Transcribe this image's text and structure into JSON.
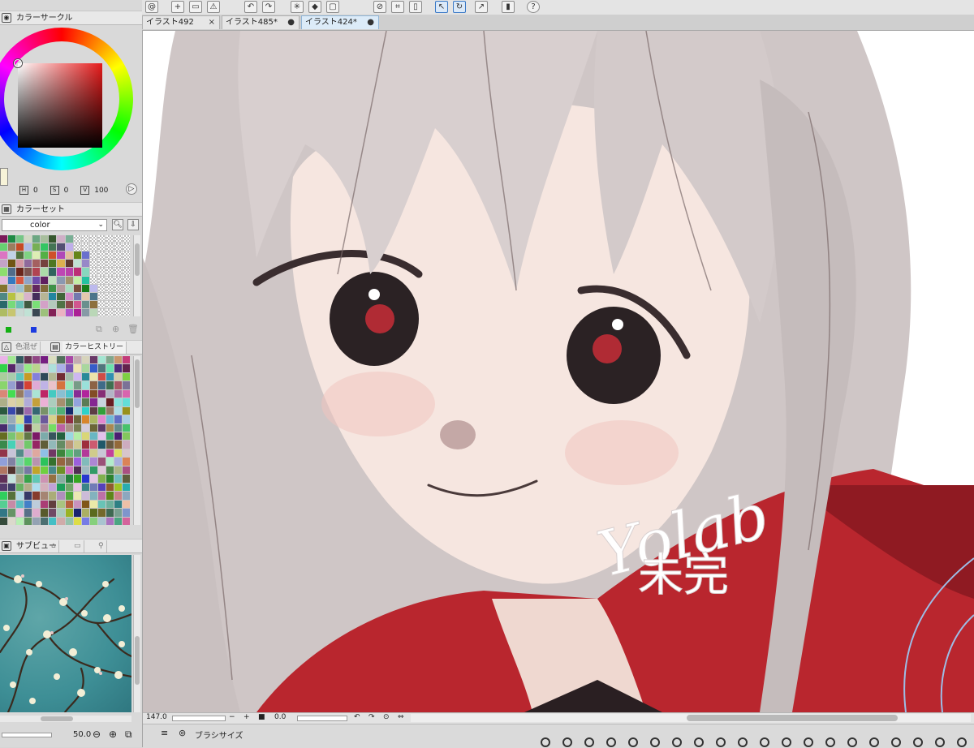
{
  "colors": {
    "accent": "#3a79c6",
    "panel_bg": "#d9d9d9",
    "coat_red": "#b9262e",
    "hair": "#cdc3c3"
  },
  "tabs": [
    {
      "label": "イラスト492",
      "close": "×"
    },
    {
      "label": "イラスト485*",
      "close": "●"
    },
    {
      "label": "イラスト424*",
      "close": "●"
    }
  ],
  "color_circle": {
    "title": "カラーサークル",
    "h_label": "H",
    "h": "0",
    "s_label": "S",
    "s": "0",
    "v_label": "V",
    "v": "100"
  },
  "color_set": {
    "title": "カラーセット",
    "selected": "color"
  },
  "history_panel": {
    "tab_inactive": "色混ぜ",
    "title": "カラーヒストリー"
  },
  "subview": {
    "title": "サブビュー"
  },
  "canvas_status": {
    "zoom": "147.0",
    "minus": "−",
    "plus": "+",
    "angle": "0.0"
  },
  "navigator": {
    "zoom_value": "50.0"
  },
  "brush_panel": {
    "title": "ブラシサイズ"
  },
  "canvas_text": {
    "signature": "Yolab",
    "signature_jp": "未完"
  }
}
